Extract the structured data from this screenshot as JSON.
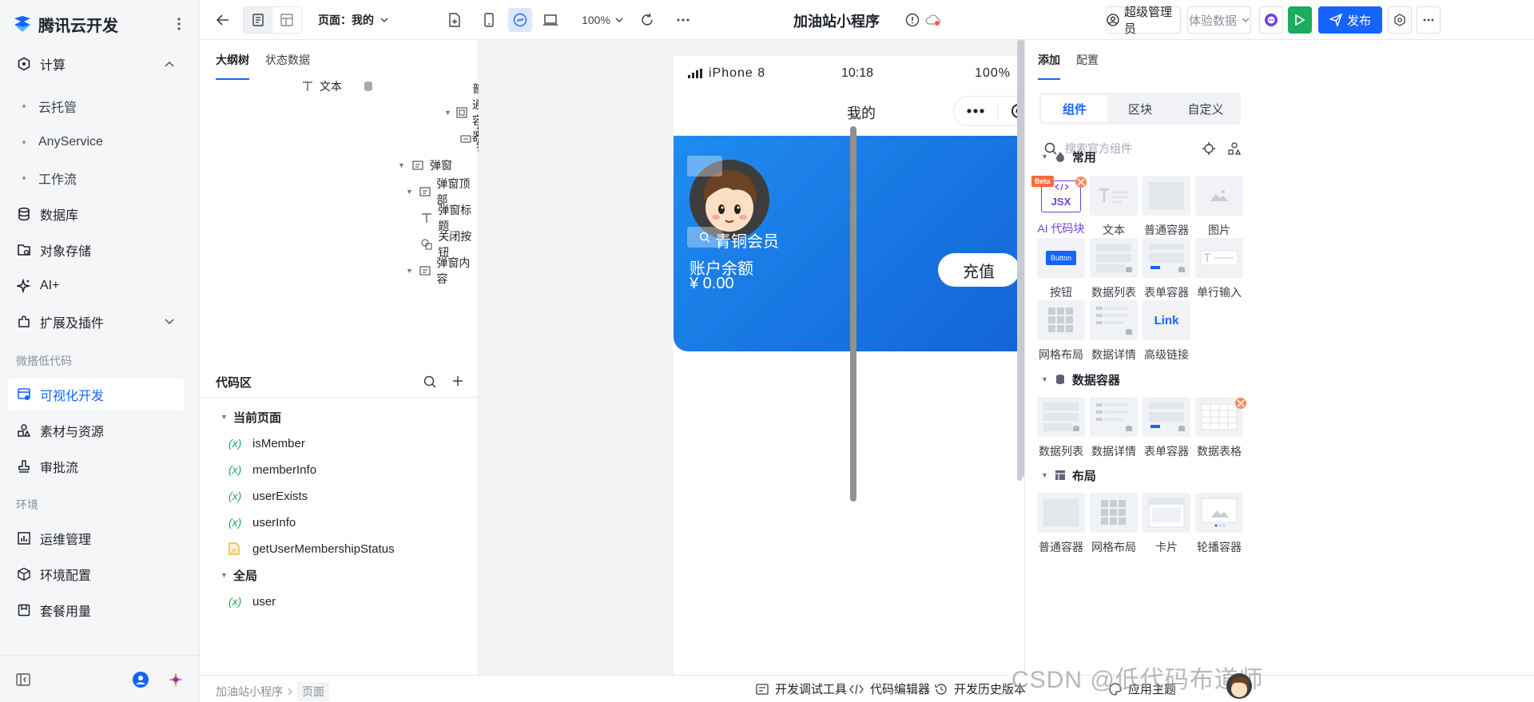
{
  "brand": {
    "name": "腾讯云开发",
    "logo_color": "#1664ff"
  },
  "nav": {
    "compute": "计算",
    "compute_children": [
      "云托管",
      "AnyService",
      "工作流"
    ],
    "database": "数据库",
    "object_storage": "对象存储",
    "ai_plus": "AI+",
    "extensions": "扩展及插件",
    "group_lowcode": "微搭低代码",
    "visual_dev": "可视化开发",
    "assets": "素材与资源",
    "approval": "审批流",
    "group_env": "环境",
    "ops": "运维管理",
    "env_config": "环境配置",
    "package_usage": "套餐用量"
  },
  "topbar": {
    "page_selector": "页面：我的",
    "zoom": "100%",
    "app_title": "加油站小程序",
    "admin": "超级管理员",
    "data_mode": "体验数据",
    "publish": "发布"
  },
  "outline": {
    "tabs": [
      "大纲树",
      "状态数据"
    ],
    "nodes": [
      {
        "label": "文本"
      },
      {
        "label": "普通容器"
      },
      {
        "label": "按钮"
      },
      {
        "label": "弹窗"
      },
      {
        "label": "弹窗顶部"
      },
      {
        "label": "弹窗标题"
      },
      {
        "label": "关闭按钮"
      },
      {
        "label": "弹窗内容"
      }
    ]
  },
  "code": {
    "title": "代码区",
    "current_page": "当前页面",
    "page_items": [
      "isMember",
      "memberInfo",
      "userExists",
      "userInfo",
      "getUserMembershipStatus"
    ],
    "global": "全局",
    "global_items": [
      "user"
    ],
    "var_symbol": "(x)"
  },
  "phone": {
    "device": "iPhone 8",
    "time": "10:18",
    "battery": "100%",
    "title": "我的",
    "member_level": "青铜会员",
    "balance_label": "账户余额",
    "balance_value": "¥ 0.00",
    "recharge": "充值"
  },
  "right": {
    "tabs": [
      "添加",
      "配置"
    ],
    "segments": [
      "组件",
      "区块",
      "自定义"
    ],
    "search_placeholder": "搜索官方组件",
    "sections": {
      "common": "常用",
      "data_container": "数据容器",
      "layout": "布局"
    },
    "common_items": [
      "AI 代码块",
      "文本",
      "普通容器",
      "图片",
      "按钮",
      "数据列表",
      "表单容器",
      "单行输入",
      "网格布局",
      "数据详情",
      "高级链接"
    ],
    "data_items": [
      "数据列表",
      "数据详情",
      "表单容器",
      "数据表格"
    ],
    "layout_items": [
      "普通容器",
      "网格布局",
      "卡片",
      "轮播容器"
    ],
    "beta": "Beta",
    "jsx": "JSX",
    "button_thumb": "Button",
    "link_thumb": "Link"
  },
  "bottom": {
    "breadcrumb": [
      "加油站小程序",
      "页面"
    ],
    "devtools": "开发调试工具",
    "code_editor": "代码编辑器",
    "history": "开发历史版本",
    "theme": "应用主题"
  },
  "watermark": "CSDN @低代码布道师"
}
